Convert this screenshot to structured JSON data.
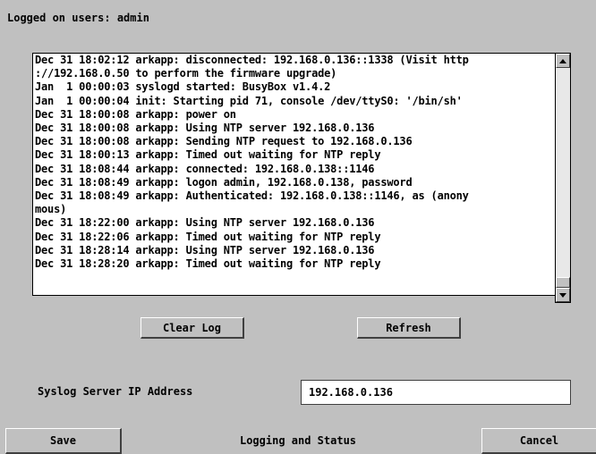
{
  "header": {
    "logged_on": "Logged on users: admin"
  },
  "log": {
    "lines": [
      "Dec 31 18:02:12 arkapp: disconnected: 192.168.0.136::1338 (Visit http",
      "://192.168.0.50 to perform the firmware upgrade)",
      "Jan  1 00:00:03 syslogd started: BusyBox v1.4.2",
      "Jan  1 00:00:04 init: Starting pid 71, console /dev/ttyS0: '/bin/sh'",
      "Dec 31 18:00:08 arkapp: power on",
      "Dec 31 18:00:08 arkapp: Using NTP server 192.168.0.136",
      "Dec 31 18:00:08 arkapp: Sending NTP request to 192.168.0.136",
      "Dec 31 18:00:13 arkapp: Timed out waiting for NTP reply",
      "Dec 31 18:08:44 arkapp: connected: 192.168.0.138::1146",
      "Dec 31 18:08:49 arkapp: logon admin, 192.168.0.138, password",
      "Dec 31 18:08:49 arkapp: Authenticated: 192.168.0.138::1146, as (anony",
      "mous)",
      "Dec 31 18:22:00 arkapp: Using NTP server 192.168.0.136",
      "Dec 31 18:22:06 arkapp: Timed out waiting for NTP reply",
      "Dec 31 18:28:14 arkapp: Using NTP server 192.168.0.136",
      "Dec 31 18:28:20 arkapp: Timed out waiting for NTP reply"
    ]
  },
  "buttons": {
    "clear_log": "Clear Log",
    "refresh": "Refresh",
    "save": "Save",
    "cancel": "Cancel"
  },
  "syslog": {
    "label": "Syslog Server IP Address",
    "value": "192.168.0.136"
  },
  "status": {
    "title": "Logging and Status"
  },
  "icons": {
    "scroll_up": "arrow-up-icon",
    "scroll_down": "arrow-down-icon"
  }
}
